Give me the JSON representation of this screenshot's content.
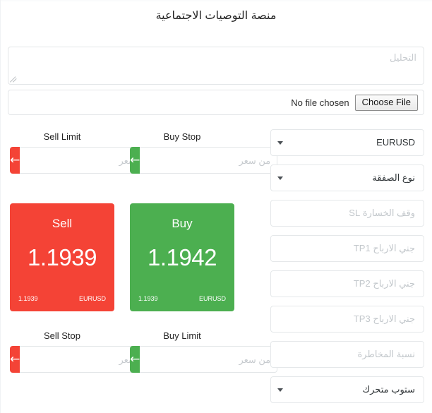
{
  "header": {
    "title": "منصة التوصيات الاجتماعية"
  },
  "analysis": {
    "placeholder": "التحليل",
    "value": "",
    "resize_handle": "resize-handle"
  },
  "attachment": {
    "button_label": "Choose File",
    "status_text": "No file chosen"
  },
  "orders": [
    {
      "name": "sell-limit",
      "label": "Sell Limit",
      "color": "#f44336",
      "color_class": "red",
      "icon": "arrow-left-icon",
      "glyph": "←",
      "placeholder": "من سعر",
      "value": ""
    },
    {
      "name": "buy-stop",
      "label": "Buy Stop",
      "color": "#4caf50",
      "color_class": "green",
      "icon": "arrow-left-icon",
      "glyph": "←",
      "placeholder": "من سعر",
      "value": ""
    },
    {
      "name": "sell-stop",
      "label": "Sell Stop",
      "color": "#f44336",
      "color_class": "red",
      "icon": "arrow-left-icon",
      "glyph": "←",
      "placeholder": "من سعر",
      "value": ""
    },
    {
      "name": "buy-limit",
      "label": "Buy Limit",
      "color": "#4caf50",
      "color_class": "green",
      "icon": "arrow-left-icon",
      "glyph": "←",
      "placeholder": "من سعر",
      "value": ""
    }
  ],
  "quotes": {
    "sell": {
      "side_label": "Sell",
      "price": "1.1939",
      "foot_left": "1.1939",
      "foot_right": "EURUSD",
      "color": "#f44336"
    },
    "buy": {
      "side_label": "Buy",
      "price": "1.1942",
      "foot_left": "1.1939",
      "foot_right": "EURUSD",
      "color": "#4caf50"
    }
  },
  "form_fields": [
    {
      "name": "symbol-select",
      "type": "select",
      "value": "EURUSD",
      "is_placeholder": false,
      "ltr": true,
      "icon": "chevron-down-icon"
    },
    {
      "name": "deal-type-select",
      "type": "select",
      "value": "نوع الصفقة",
      "is_placeholder": false,
      "ltr": false,
      "icon": "chevron-down-icon"
    },
    {
      "name": "stop-loss-input",
      "type": "input",
      "value": "وقف الخسارة SL",
      "is_placeholder": true,
      "ltr": false,
      "icon": ""
    },
    {
      "name": "take-profit-1-input",
      "type": "input",
      "value": "جني الارباح TP1",
      "is_placeholder": true,
      "ltr": false,
      "icon": ""
    },
    {
      "name": "take-profit-2-input",
      "type": "input",
      "value": "جني الارباح TP2",
      "is_placeholder": true,
      "ltr": false,
      "icon": ""
    },
    {
      "name": "take-profit-3-input",
      "type": "input",
      "value": "جني الارباح TP3",
      "is_placeholder": true,
      "ltr": false,
      "icon": ""
    },
    {
      "name": "risk-ratio-input",
      "type": "input",
      "value": "نسبة المخاطرة",
      "is_placeholder": true,
      "ltr": false,
      "icon": ""
    },
    {
      "name": "trailing-stop-select",
      "type": "select",
      "value": "ستوب متحرك",
      "is_placeholder": false,
      "ltr": false,
      "icon": "chevron-down-icon"
    }
  ]
}
